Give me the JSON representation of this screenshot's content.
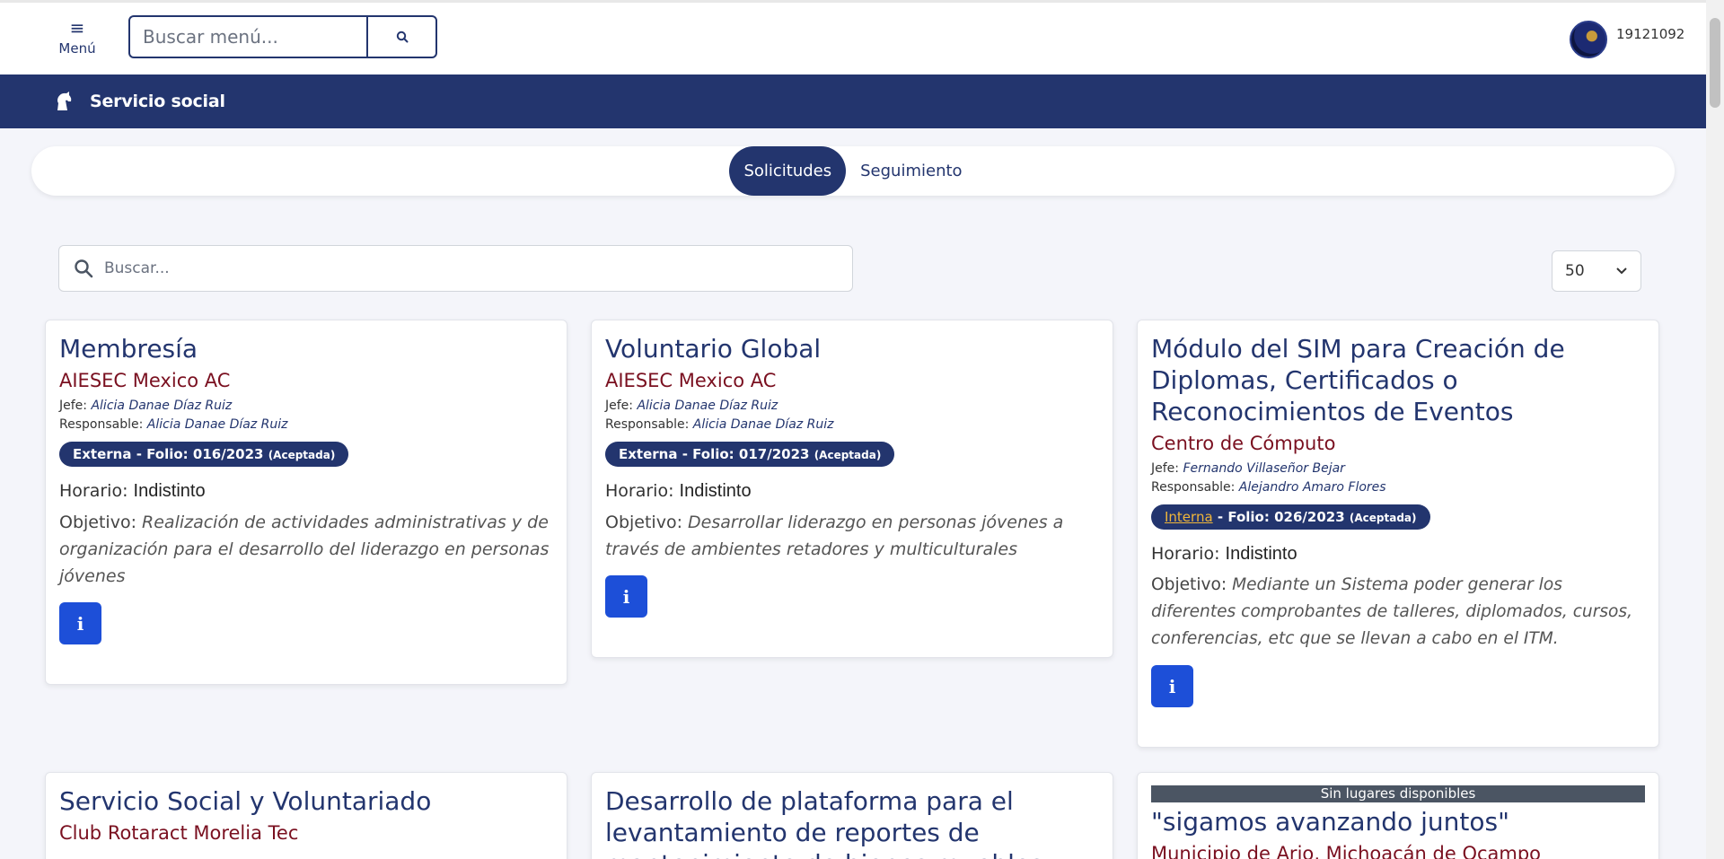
{
  "topbar": {
    "menu_label": "Menú",
    "search_placeholder": "Buscar menú...",
    "user_id": "19121092"
  },
  "banner": {
    "title": "Servicio social"
  },
  "tabs": [
    {
      "label": "Solicitudes",
      "active": true
    },
    {
      "label": "Seguimiento",
      "active": false
    }
  ],
  "filters": {
    "search_placeholder": "Buscar...",
    "page_size": "50"
  },
  "labels": {
    "jefe": "Jefe:",
    "responsable": "Responsable:",
    "horario": "Horario:",
    "objetivo": "Objetivo:",
    "folio_sep": " - Folio: ",
    "info_icon": "i"
  },
  "cards": [
    {
      "title": "Membresía",
      "org": "AIESEC Mexico AC",
      "jefe": "Alicia Danae Díaz Ruiz",
      "responsable": "Alicia Danae Díaz Ruiz",
      "tipo": "Externa",
      "folio": "016/2023",
      "estado": "(Aceptada)",
      "horario": "Indistinto",
      "objetivo": "Realización de actividades administrativas y de organización para el desarrollo del liderazgo en personas jóvenes"
    },
    {
      "title": "Voluntario Global",
      "org": "AIESEC Mexico AC",
      "jefe": "Alicia Danae Díaz Ruiz",
      "responsable": "Alicia Danae Díaz Ruiz",
      "tipo": "Externa",
      "folio": "017/2023",
      "estado": "(Aceptada)",
      "horario": "Indistinto",
      "objetivo": "Desarrollar liderazgo en personas jóvenes a través de ambientes retadores y multiculturales"
    },
    {
      "title": "Módulo del SIM para Creación de Diplomas, Certificados o Reconocimientos de Eventos",
      "org": "Centro de Cómputo",
      "jefe": "Fernando Villaseñor Bejar",
      "responsable": "Alejandro Amaro Flores",
      "tipo": "Interna",
      "folio": "026/2023",
      "estado": "(Aceptada)",
      "horario": "Indistinto",
      "objetivo": "Mediante un Sistema poder generar los diferentes comprobantes de talleres, diplomados, cursos, conferencias, etc que se llevan a cabo en el ITM."
    },
    {
      "title": "Servicio Social y Voluntariado",
      "org": "Club Rotaract Morelia Tec"
    },
    {
      "title": "Desarrollo de plataforma para el levantamiento de reportes de mantenimiento de bienes muebles"
    },
    {
      "notice": "Sin lugares disponibles",
      "title": "\"sigamos avanzando juntos\"",
      "org": "Municipio de Ario, Michoacán de Ocampo"
    }
  ],
  "colors": {
    "primary": "#23356e",
    "org_text": "#7a1020",
    "info_button": "#1d4fd8",
    "interna_link": "#f0b63a",
    "notice_bg": "#4b5563"
  }
}
